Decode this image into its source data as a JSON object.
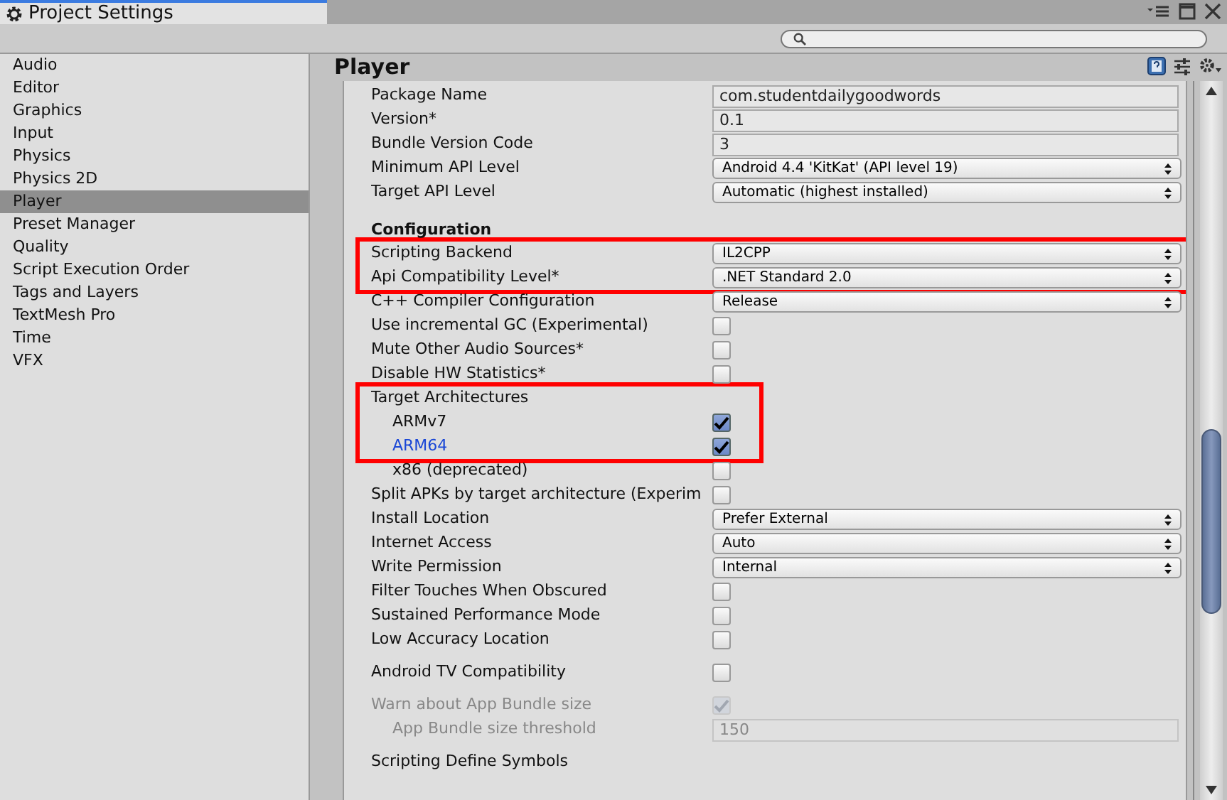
{
  "window": {
    "title": "Project Settings"
  },
  "sidebar": {
    "items": [
      {
        "label": "Audio",
        "selected": false
      },
      {
        "label": "Editor",
        "selected": false
      },
      {
        "label": "Graphics",
        "selected": false
      },
      {
        "label": "Input",
        "selected": false
      },
      {
        "label": "Physics",
        "selected": false
      },
      {
        "label": "Physics 2D",
        "selected": false
      },
      {
        "label": "Player",
        "selected": true
      },
      {
        "label": "Preset Manager",
        "selected": false
      },
      {
        "label": "Quality",
        "selected": false
      },
      {
        "label": "Script Execution Order",
        "selected": false
      },
      {
        "label": "Tags and Layers",
        "selected": false
      },
      {
        "label": "TextMesh Pro",
        "selected": false
      },
      {
        "label": "Time",
        "selected": false
      },
      {
        "label": "VFX",
        "selected": false
      }
    ]
  },
  "panel": {
    "title": "Player",
    "rows": [
      {
        "kind": "field",
        "label": "Package Name",
        "value": "com.studentdailygoodwords",
        "disabled": false,
        "highlighted": false
      },
      {
        "kind": "field",
        "label": "Version*",
        "value": "0.1",
        "disabled": false,
        "highlighted": false
      },
      {
        "kind": "field",
        "label": "Bundle Version Code",
        "value": "3",
        "disabled": false,
        "highlighted": false
      },
      {
        "kind": "dropdown",
        "label": "Minimum API Level",
        "value": "Android 4.4 'KitKat' (API level 19)",
        "disabled": false,
        "highlighted": false
      },
      {
        "kind": "dropdown",
        "label": "Target API Level",
        "value": "Automatic (highest installed)",
        "disabled": false,
        "highlighted": false
      },
      {
        "kind": "spacer"
      },
      {
        "kind": "header",
        "label": "Configuration"
      },
      {
        "kind": "dropdown",
        "label": "Scripting Backend",
        "value": "IL2CPP",
        "disabled": false,
        "highlighted": true
      },
      {
        "kind": "dropdown",
        "label": "Api Compatibility Level*",
        "value": ".NET Standard 2.0",
        "disabled": false,
        "highlighted": true
      },
      {
        "kind": "dropdown",
        "label": "C++ Compiler Configuration",
        "value": "Release",
        "disabled": false,
        "highlighted": false
      },
      {
        "kind": "checkbox",
        "label": "Use incremental GC (Experimental)",
        "checked": false,
        "disabled": false,
        "highlighted": false
      },
      {
        "kind": "checkbox",
        "label": "Mute Other Audio Sources*",
        "checked": false,
        "disabled": false,
        "highlighted": false
      },
      {
        "kind": "checkbox",
        "label": "Disable HW Statistics*",
        "checked": false,
        "disabled": false,
        "highlighted": false
      },
      {
        "kind": "label",
        "label": "Target Architectures",
        "disabled": false,
        "highlighted": true,
        "children": [
          {
            "kind": "checkbox",
            "label": "ARMv7",
            "checked": true,
            "disabled": false,
            "highlighted": true
          },
          {
            "kind": "checkbox",
            "label": "ARM64",
            "checked": true,
            "disabled": false,
            "highlighted": true,
            "color": "#1a47d6"
          },
          {
            "kind": "checkbox",
            "label": "x86 (deprecated)",
            "checked": false,
            "disabled": false,
            "highlighted": false
          }
        ]
      },
      {
        "kind": "checkbox",
        "label": "Split APKs by target architecture (Experim",
        "checked": false,
        "disabled": false,
        "highlighted": false
      },
      {
        "kind": "dropdown",
        "label": "Install Location",
        "value": "Prefer External",
        "disabled": false,
        "highlighted": false
      },
      {
        "kind": "dropdown",
        "label": "Internet Access",
        "value": "Auto",
        "disabled": false,
        "highlighted": false
      },
      {
        "kind": "dropdown",
        "label": "Write Permission",
        "value": "Internal",
        "disabled": false,
        "highlighted": false
      },
      {
        "kind": "checkbox",
        "label": "Filter Touches When Obscured",
        "checked": false,
        "disabled": false,
        "highlighted": false
      },
      {
        "kind": "checkbox",
        "label": "Sustained Performance Mode",
        "checked": false,
        "disabled": false,
        "highlighted": false
      },
      {
        "kind": "checkbox",
        "label": "Low Accuracy Location",
        "checked": false,
        "disabled": false,
        "highlighted": false
      },
      {
        "kind": "spacer"
      },
      {
        "kind": "checkbox",
        "label": "Android TV Compatibility",
        "checked": false,
        "disabled": false,
        "highlighted": false
      },
      {
        "kind": "spacer"
      },
      {
        "kind": "checkbox",
        "label": "Warn about App Bundle size",
        "checked": true,
        "disabled": true,
        "highlighted": false,
        "children": [
          {
            "kind": "field",
            "label": "App Bundle size threshold",
            "value": "150",
            "disabled": true,
            "highlighted": false
          }
        ]
      },
      {
        "kind": "spacer"
      },
      {
        "kind": "label",
        "label": "Scripting Define Symbols",
        "disabled": false,
        "highlighted": false
      }
    ]
  }
}
